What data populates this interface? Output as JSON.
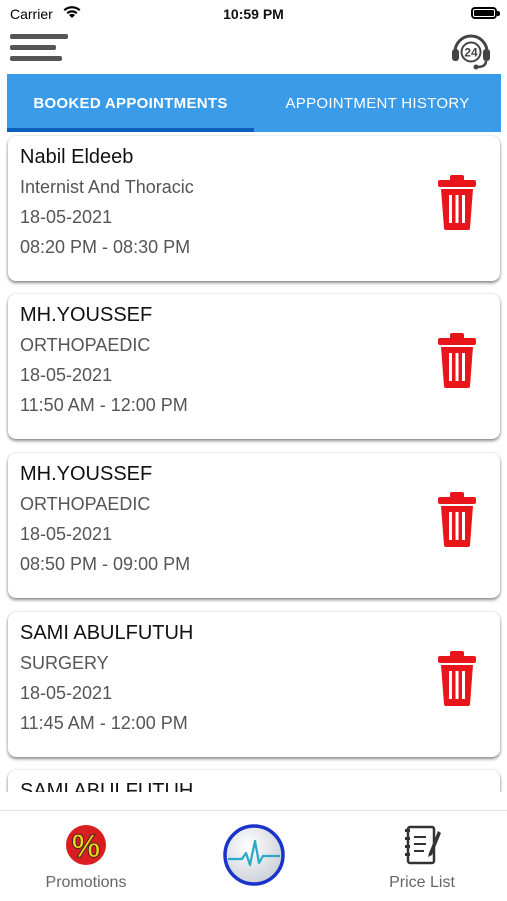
{
  "status_bar": {
    "carrier": "Carrier",
    "time": "10:59 PM"
  },
  "header": {
    "menu_icon": "hamburger-menu-icon",
    "support_icon": "headset-24-icon",
    "support_badge": "24"
  },
  "tabs": [
    {
      "label": "BOOKED APPOINTMENTS",
      "active": true
    },
    {
      "label": "APPOINTMENT HISTORY",
      "active": false
    }
  ],
  "appointments": [
    {
      "doctor": "Nabil Eldeeb",
      "specialty": "Internist And Thoracic",
      "date": "18-05-2021",
      "time": "08:20 PM - 08:30 PM"
    },
    {
      "doctor": "MH.YOUSSEF",
      "specialty": "ORTHOPAEDIC",
      "date": "18-05-2021",
      "time": "11:50 AM - 12:00 PM"
    },
    {
      "doctor": "MH.YOUSSEF",
      "specialty": "ORTHOPAEDIC",
      "date": "18-05-2021",
      "time": "08:50 PM - 09:00 PM"
    },
    {
      "doctor": "SAMI ABULFUTUH",
      "specialty": "SURGERY",
      "date": "18-05-2021",
      "time": "11:45 AM - 12:00 PM"
    },
    {
      "doctor": "SAMI ABULFUTUH",
      "specialty": "",
      "date": "",
      "time": ""
    }
  ],
  "bottom_nav": {
    "promotions": {
      "label": "Promotions",
      "icon": "percent-badge-icon"
    },
    "center": {
      "icon": "heartbeat-icon"
    },
    "price_list": {
      "label": "Price List",
      "icon": "price-list-icon"
    }
  },
  "colors": {
    "tab_bar": "#3a9be8",
    "tab_indicator": "#0a5fbf",
    "delete_icon": "#e8161b",
    "promo_badge": "#d81e1e"
  }
}
